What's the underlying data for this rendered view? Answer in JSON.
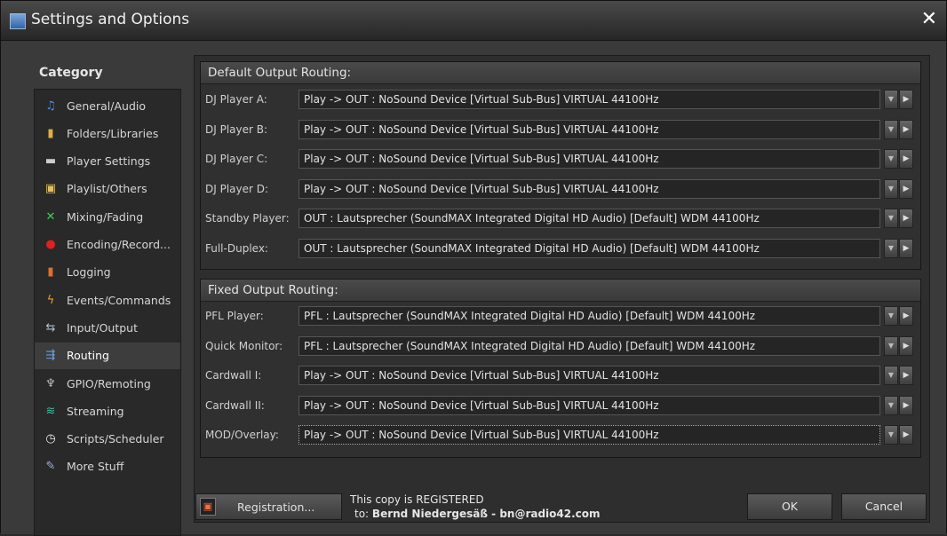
{
  "window": {
    "title": "Settings and Options",
    "close_symbol": "✕"
  },
  "category": {
    "title": "Category",
    "items": [
      {
        "label": "General/Audio",
        "icon": "music-note-icon",
        "glyph": "♫",
        "color": "#4a8fe0"
      },
      {
        "label": "Folders/Libraries",
        "icon": "folder-icon",
        "glyph": "▮",
        "color": "#e0b040"
      },
      {
        "label": "Player Settings",
        "icon": "player-icon",
        "glyph": "▬",
        "color": "#cccccc"
      },
      {
        "label": "Playlist/Others",
        "icon": "playlist-icon",
        "glyph": "▣",
        "color": "#e0c060"
      },
      {
        "label": "Mixing/Fading",
        "icon": "mixing-icon",
        "glyph": "✕",
        "color": "#3fcf5a"
      },
      {
        "label": "Encoding/Record...",
        "icon": "record-icon",
        "glyph": "●",
        "color": "#e02020"
      },
      {
        "label": "Logging",
        "icon": "logging-icon",
        "glyph": "▮",
        "color": "#e07030"
      },
      {
        "label": "Events/Commands",
        "icon": "lightning-icon",
        "glyph": "ϟ",
        "color": "#f0a020"
      },
      {
        "label": "Input/Output",
        "icon": "input-output-icon",
        "glyph": "⇆",
        "color": "#b0c0d0"
      },
      {
        "label": "Routing",
        "icon": "routing-icon",
        "glyph": "⇶",
        "color": "#6aa0e0"
      },
      {
        "label": "GPIO/Remoting",
        "icon": "gpio-icon",
        "glyph": "♆",
        "color": "#bbbbbb"
      },
      {
        "label": "Streaming",
        "icon": "streaming-icon",
        "glyph": "≋",
        "color": "#30c0a0"
      },
      {
        "label": "Scripts/Scheduler",
        "icon": "clock-icon",
        "glyph": "◷",
        "color": "#eeeeee"
      },
      {
        "label": "More Stuff",
        "icon": "more-stuff-icon",
        "glyph": "✎",
        "color": "#9ab0e0"
      }
    ],
    "selected": "Routing"
  },
  "default_routing": {
    "title": "Default Output Routing:",
    "rows": [
      {
        "label": "DJ Player A:",
        "value": "Play  -> OUT  : NoSound Device [Virtual Sub-Bus] VIRTUAL 44100Hz"
      },
      {
        "label": "DJ Player B:",
        "value": "Play  -> OUT  : NoSound Device [Virtual Sub-Bus] VIRTUAL 44100Hz"
      },
      {
        "label": "DJ Player C:",
        "value": "Play  -> OUT  : NoSound Device [Virtual Sub-Bus] VIRTUAL 44100Hz"
      },
      {
        "label": "DJ Player D:",
        "value": "Play  -> OUT  : NoSound Device [Virtual Sub-Bus] VIRTUAL 44100Hz"
      },
      {
        "label": "Standby Player:",
        "value": "OUT  : Lautsprecher (SoundMAX Integrated Digital HD Audio) [Default] WDM 44100Hz"
      },
      {
        "label": "Full-Duplex:",
        "value": "OUT  : Lautsprecher (SoundMAX Integrated Digital HD Audio) [Default] WDM 44100Hz"
      }
    ]
  },
  "fixed_routing": {
    "title": "Fixed Output Routing:",
    "rows": [
      {
        "label": "PFL Player:",
        "value": "PFL  : Lautsprecher (SoundMAX Integrated Digital HD Audio) [Default] WDM 44100Hz"
      },
      {
        "label": "Quick Monitor:",
        "value": "PFL  : Lautsprecher (SoundMAX Integrated Digital HD Audio) [Default] WDM 44100Hz"
      },
      {
        "label": "Cardwall I:",
        "value": "Play  -> OUT  : NoSound Device [Virtual Sub-Bus] VIRTUAL 44100Hz"
      },
      {
        "label": "Cardwall II:",
        "value": "Play  -> OUT  : NoSound Device [Virtual Sub-Bus] VIRTUAL 44100Hz"
      },
      {
        "label": "MOD/Overlay:",
        "value": "Play  -> OUT  : NoSound Device [Virtual Sub-Bus] VIRTUAL 44100Hz"
      }
    ]
  },
  "footer": {
    "registration_label": "Registration...",
    "registered_text": "This copy is REGISTERED",
    "to_prefix": "to:",
    "registered_to": "Bernd Niedergesäß - bn@radio42.com",
    "ok_label": "OK",
    "cancel_label": "Cancel"
  }
}
